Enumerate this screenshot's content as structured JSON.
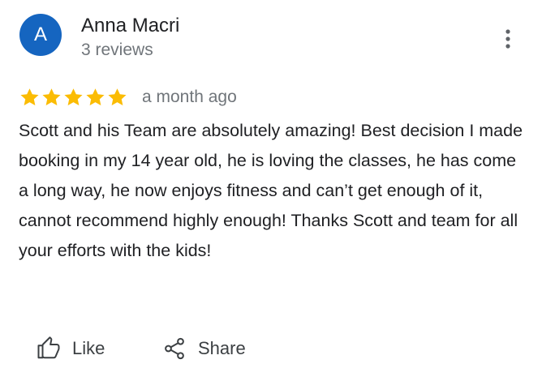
{
  "review": {
    "author": {
      "initial": "A",
      "name": "Anna Macri",
      "review_count": "3 reviews",
      "avatar_color": "#1565c0"
    },
    "rating": 5,
    "max_rating": 5,
    "star_color": "#fbbc04",
    "timestamp": "a month ago",
    "text": "Scott and his Team are absolutely amazing! Best decision I made booking in my 14 year old, he is loving the classes, he has come a long way, he now enjoys fitness and can’t get enough of it, cannot recommend highly enough! Thanks Scott and team for all your efforts with the kids!"
  },
  "menu": {
    "icon": "more-vert-icon"
  },
  "actions": {
    "like_label": "Like",
    "like_icon": "thumb-up-icon",
    "share_label": "Share",
    "share_icon": "share-icon"
  }
}
